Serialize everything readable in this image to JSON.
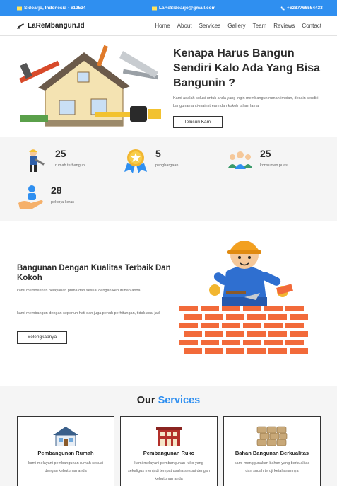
{
  "topbar": {
    "location": "Sidoarjo, Indonesia - 612534",
    "email": "LaReSidoarjo@gmail.com",
    "phone": "+6287766554433"
  },
  "nav": {
    "brand": "LaReMbangun.Id",
    "links": [
      "Home",
      "About",
      "Services",
      "Gallery",
      "Team",
      "Reviews",
      "Contact"
    ]
  },
  "hero": {
    "title": "Kenapa Harus Bangun Sendiri Kalo Ada Yang Bisa Bangunin ?",
    "description": "Kami adalah solusi untuk anda yang ingin membangun rumah impian, desain sendiri, bangunan anti-mainstream dan kokoh tahan lama",
    "button": "Telusuri Kami"
  },
  "stats": [
    {
      "value": "25",
      "label": "rumah terbangun",
      "icon": "builder-icon"
    },
    {
      "value": "5",
      "label": "penghargaan",
      "icon": "award-medal-icon"
    },
    {
      "value": "25",
      "label": "konsumen puas",
      "icon": "customers-icon"
    },
    {
      "value": "28",
      "label": "pekerja keras",
      "icon": "worker-hand-icon"
    }
  ],
  "quality": {
    "title": "Bangunan Dengan Kualitas Terbaik Dan Kokoh",
    "p1": "kami memberikan pelayanan prima dan sesuai dengan kebutuhan anda",
    "p2": "kami membangun dengan sepenuh hati dan juga penuh perhitungan, tidak asal jadi",
    "button": "Selengkapnya"
  },
  "services": {
    "title_part1": "Our",
    "title_part2": "Services",
    "cards": [
      {
        "title": "Pembangunan Rumah",
        "desc": "kami melayani pembangunan rumah sesuai dengan kebutuhan anda",
        "icon": "house-icon"
      },
      {
        "title": "Pembangunan Ruko",
        "desc": "kami melayani pembangunan ruko yang sekaligus menjadi tempat usaha sesuai dengan kebutuhan anda",
        "icon": "shophouse-icon"
      },
      {
        "title": "Bahan Bangunan Berkualitas",
        "desc": "kami menggunakan bahan yang berkualitas dan sudah teruji ketahanannya",
        "icon": "sandbags-icon"
      }
    ]
  },
  "colors": {
    "accent": "#2f8ff0",
    "dark_text": "#2b2b2b",
    "light_bg": "#f5f5f5",
    "brick": "#f26a3a"
  }
}
